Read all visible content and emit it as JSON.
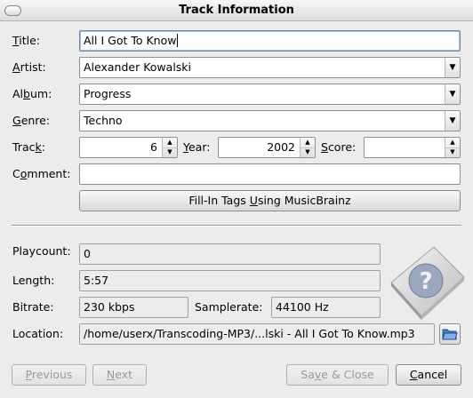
{
  "window": {
    "title": "Track Information"
  },
  "tags": {
    "title": {
      "label_pre": "",
      "label_key": "T",
      "label_post": "itle:",
      "value": "All I Got To Know"
    },
    "artist": {
      "label_pre": "",
      "label_key": "A",
      "label_post": "rtist:",
      "value": "Alexander Kowalski"
    },
    "album": {
      "label_pre": "Al",
      "label_key": "b",
      "label_post": "um:",
      "value": "Progress"
    },
    "genre": {
      "label_pre": "",
      "label_key": "G",
      "label_post": "enre:",
      "value": "Techno"
    },
    "track": {
      "label_pre": "Trac",
      "label_key": "k",
      "label_post": ":",
      "value": "6"
    },
    "year": {
      "label_pre": "",
      "label_key": "Y",
      "label_post": "ear:",
      "value": "2002"
    },
    "score": {
      "label_pre": "",
      "label_key": "S",
      "label_post": "core:",
      "value": ""
    },
    "comment": {
      "label_pre": "C",
      "label_key": "o",
      "label_post": "mment:",
      "value": ""
    }
  },
  "musicbrainz": {
    "pre": "Fill-In Tags ",
    "key": "U",
    "post": "sing MusicBrainz"
  },
  "info": {
    "playcount": {
      "label": "Playcount:",
      "value": "0"
    },
    "length": {
      "label": "Length:",
      "value": "5:57"
    },
    "bitrate": {
      "label": "Bitrate:",
      "value": "230 kbps"
    },
    "samplerate": {
      "label": "Samplerate:",
      "value": "44100 Hz"
    },
    "location": {
      "label": "Location:",
      "value": "/home/userx/Transcoding-MP3/...lski - All I Got To Know.mp3"
    }
  },
  "buttons": {
    "previous": {
      "pre": "",
      "key": "P",
      "post": "revious"
    },
    "next": {
      "pre": "",
      "key": "N",
      "post": "ext"
    },
    "save_close": {
      "pre": "Sa",
      "key": "v",
      "post": "e & Close"
    },
    "cancel": {
      "pre": "",
      "key": "C",
      "post": "ancel"
    }
  },
  "icons": {
    "cover": "question-mark-cover-icon",
    "folder": "folder-open-icon"
  }
}
